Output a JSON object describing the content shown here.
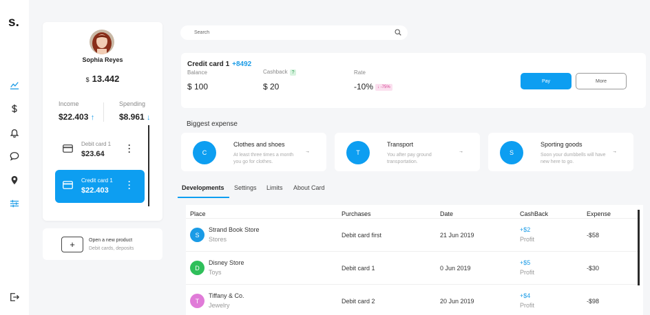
{
  "app": {
    "logo": "s."
  },
  "rail": {
    "icons": [
      "chart-line-icon",
      "dollar-icon",
      "bell-icon",
      "chat-icon",
      "location-pin-icon",
      "sliders-icon",
      "logout-icon"
    ],
    "active": "sliders-icon"
  },
  "profile": {
    "name": "Sophia Reyes",
    "currency": "$",
    "balance": "13.442",
    "income_label": "Income",
    "income_value": "$22.403",
    "spending_label": "Spending",
    "spending_value": "$8.961",
    "cards": [
      {
        "label": "Debit card 1",
        "value": "$23.64"
      },
      {
        "label": "Credit card 1",
        "value": "$22.403"
      }
    ]
  },
  "new_product": {
    "icon": "+",
    "title": "Open a new product",
    "subtitle": "Debit cards, deposits"
  },
  "search": {
    "placeholder": "Search"
  },
  "credit_card": {
    "title": "Credit card 1",
    "amount": "+8492",
    "balance_label": "Balance",
    "balance_value": "$ 100",
    "cashback_label": "Cashback",
    "cashback_badge": "?",
    "cashback_value": "$ 20",
    "rate_label": "Rate",
    "rate_value": "-10%",
    "rate_badge": "↓ -75%",
    "pay_label": "Pay",
    "more_label": "More"
  },
  "biggest_expense": {
    "title": "Biggest expense",
    "items": [
      {
        "initial": "C",
        "title": "Clothes and shoes",
        "desc": "At least three times a month you go for clothes."
      },
      {
        "initial": "T",
        "title": "Transport",
        "desc": "You after pay ground transportation."
      },
      {
        "initial": "S",
        "title": "Sporting goods",
        "desc": "Soon your dumbbells will have new here to go."
      }
    ]
  },
  "tabs": [
    "Developments",
    "Settings",
    "Limits",
    "About Card"
  ],
  "table": {
    "headers": [
      "Place",
      "Purchases",
      "Date",
      "CashBack",
      "Expense"
    ],
    "rows": [
      {
        "initial": "S",
        "color": "#1a9be6",
        "place": "Strand Book Store",
        "category": "Stores",
        "purchase": "Debit card first",
        "date": "21 Jun 2019",
        "cashback": "+$2",
        "cashback_sub": "Profit",
        "expense": "-$58"
      },
      {
        "initial": "D",
        "color": "#2fbf5a",
        "place": "Disney Store",
        "category": "Toys",
        "purchase": "Debit card 1",
        "date": "0 Jun 2019",
        "cashback": "+$5",
        "cashback_sub": "Profit",
        "expense": "-$30"
      },
      {
        "initial": "T",
        "color": "#e07bd8",
        "place": "Tiffany & Co.",
        "category": "Jewelry",
        "purchase": "Debit card 2",
        "date": "20 Jun 2019",
        "cashback": "+$4",
        "cashback_sub": "Profit",
        "expense": "-$98"
      }
    ]
  }
}
